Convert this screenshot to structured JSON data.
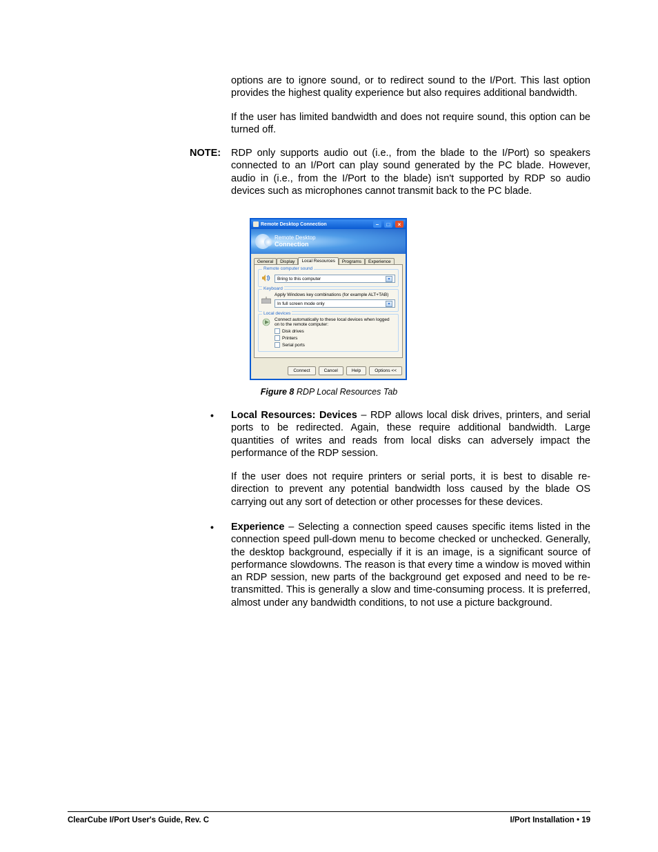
{
  "para1": "options are to ignore sound, or to redirect sound to the I/Port. This last option provides the highest quality experience but also requires additional bandwidth.",
  "para2": "If the user has limited bandwidth and does not require sound, this option can be turned off.",
  "note": {
    "label": "NOTE:",
    "body": "RDP only supports audio out (i.e., from the blade to the I/Port) so speakers connected to an I/Port can play sound generated by the PC blade. However, audio in (i.e., from the I/Port to the blade) isn't supported by RDP so audio devices such as microphones cannot transmit back to the PC blade."
  },
  "rdp": {
    "title": "Remote Desktop Connection",
    "banner_line1": "Remote Desktop",
    "banner_line2": "Connection",
    "tabs": {
      "general": "General",
      "display": "Display",
      "local": "Local Resources",
      "programs": "Programs",
      "experience": "Experience"
    },
    "sound": {
      "legend": "Remote computer sound",
      "value": "Bring to this computer"
    },
    "keyboard": {
      "legend": "Keyboard",
      "desc": "Apply Windows key combinations (for example ALT+TAB)",
      "value": "In full screen mode only"
    },
    "devices": {
      "legend": "Local devices",
      "desc": "Connect automatically to these local devices when logged on to the remote computer:",
      "chk1": "Disk drives",
      "chk2": "Printers",
      "chk3": "Serial ports"
    },
    "buttons": {
      "connect": "Connect",
      "cancel": "Cancel",
      "help": "Help",
      "options": "Options <<"
    },
    "figure_label": "Figure 8",
    "figure_title": "  RDP Local Resources Tab"
  },
  "bullet_devices": {
    "lead": "Local Resources: Devices",
    "rest": " – RDP allows local disk drives, printers, and serial ports to be redirected. Again, these require additional bandwidth. Large quantities of writes and reads from local disks can adversely impact the performance of the RDP session.",
    "sub": "If the user does not require printers or serial ports, it is best to disable re-direction to prevent any potential bandwidth loss caused by the blade OS carrying out any sort of detection or other processes for these devices."
  },
  "bullet_experience": {
    "lead": "Experience",
    "rest": " – Selecting a connection speed causes specific items listed in the connection speed pull-down menu to become checked or unchecked. Generally, the desktop background, especially if it is an image, is a significant source of performance slowdowns. The reason is that every time a window is moved within an RDP session, new parts of the background get exposed and need to be re-transmitted. This is generally a slow and time-consuming process. It is preferred, almost under any bandwidth conditions, to not use a picture background."
  },
  "footer": {
    "left": "ClearCube I/Port User's Guide, Rev. C",
    "right_label": "I/Port Installation • ",
    "right_page": "19"
  }
}
